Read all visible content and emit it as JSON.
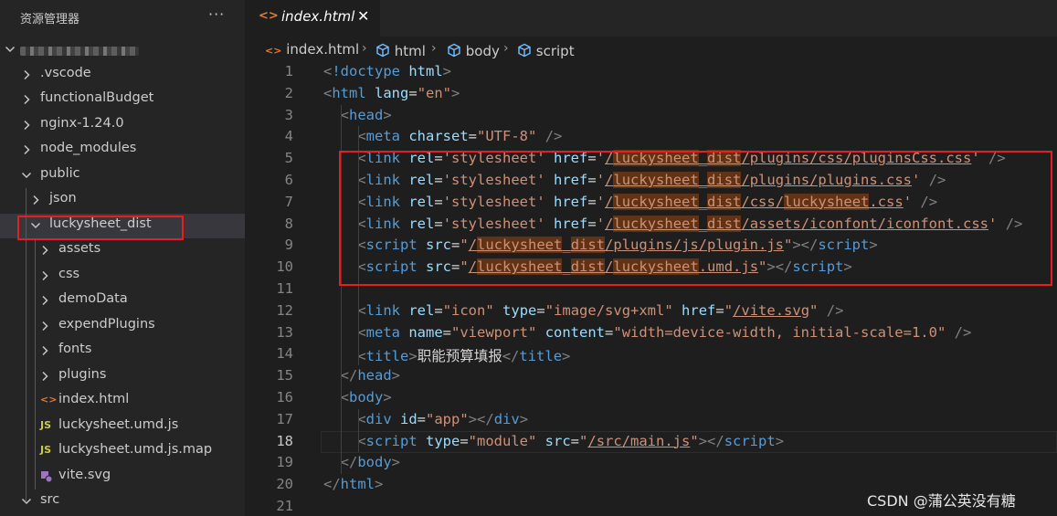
{
  "sidebar": {
    "title": "资源管理器",
    "more_actions": "···",
    "highlight_color": "#e51e1e",
    "tree": [
      {
        "label": "",
        "kind": "folder-open",
        "icon": "chevron-down-icon",
        "blurred": true
      },
      {
        "label": ".vscode",
        "kind": "folder",
        "icon": "chevron-right-icon"
      },
      {
        "label": "functionalBudget",
        "kind": "folder",
        "icon": "chevron-right-icon"
      },
      {
        "label": "nginx-1.24.0",
        "kind": "folder",
        "icon": "chevron-right-icon"
      },
      {
        "label": "node_modules",
        "kind": "folder",
        "icon": "chevron-right-icon"
      },
      {
        "label": "public",
        "kind": "folder-open",
        "icon": "chevron-down-icon"
      },
      {
        "label": "json",
        "kind": "folder",
        "icon": "chevron-right-icon"
      },
      {
        "label": "luckysheet_dist",
        "kind": "folder-open",
        "icon": "chevron-down-icon",
        "selected": true
      },
      {
        "label": "assets",
        "kind": "folder",
        "icon": "chevron-right-icon"
      },
      {
        "label": "css",
        "kind": "folder",
        "icon": "chevron-right-icon"
      },
      {
        "label": "demoData",
        "kind": "folder",
        "icon": "chevron-right-icon"
      },
      {
        "label": "expendPlugins",
        "kind": "folder",
        "icon": "chevron-right-icon"
      },
      {
        "label": "fonts",
        "kind": "folder",
        "icon": "chevron-right-icon"
      },
      {
        "label": "plugins",
        "kind": "folder",
        "icon": "chevron-right-icon"
      },
      {
        "label": "index.html",
        "kind": "file",
        "icon": "html-file-icon",
        "glyph": "<>",
        "color": "#e37933"
      },
      {
        "label": "luckysheet.umd.js",
        "kind": "file",
        "icon": "js-file-icon",
        "glyph": "JS",
        "color": "#cbcb41"
      },
      {
        "label": "luckysheet.umd.js.map",
        "kind": "file",
        "icon": "js-file-icon",
        "glyph": "JS",
        "color": "#cbcb41"
      },
      {
        "label": "vite.svg",
        "kind": "file",
        "icon": "svg-file-icon",
        "color": "#a074c4"
      },
      {
        "label": "src",
        "kind": "folder-open",
        "icon": "chevron-down-icon"
      }
    ]
  },
  "tab": {
    "icon_glyph": "<>",
    "label": "index.html",
    "close": "✕"
  },
  "breadcrumb": {
    "file": "index.html",
    "items": [
      "html",
      "body",
      "script"
    ],
    "separator": "›"
  },
  "editor": {
    "current_line": 18,
    "highlight_lines": [
      5,
      10
    ],
    "lines": [
      [
        [
          "p",
          "<"
        ],
        [
          "t",
          "!doctype "
        ],
        [
          "a",
          "html"
        ],
        [
          "p",
          ">"
        ]
      ],
      [
        [
          "p",
          "<"
        ],
        [
          "t",
          "html "
        ],
        [
          "a",
          "lang"
        ],
        [
          "x",
          "="
        ],
        [
          "s",
          "\"en\""
        ],
        [
          "p",
          ">"
        ]
      ],
      [
        [
          "x",
          "  "
        ],
        [
          "p",
          "<"
        ],
        [
          "t",
          "head"
        ],
        [
          "p",
          ">"
        ]
      ],
      [
        [
          "x",
          "    "
        ],
        [
          "p",
          "<"
        ],
        [
          "t",
          "meta "
        ],
        [
          "a",
          "charset"
        ],
        [
          "x",
          "="
        ],
        [
          "s",
          "\"UTF-8\""
        ],
        [
          "x",
          " "
        ],
        [
          "p",
          "/>"
        ]
      ],
      [
        [
          "x",
          "    "
        ],
        [
          "p",
          "<"
        ],
        [
          "t",
          "link "
        ],
        [
          "a",
          "rel"
        ],
        [
          "x",
          "="
        ],
        [
          "s",
          "'stylesheet'"
        ],
        [
          "x",
          " "
        ],
        [
          "a",
          "href"
        ],
        [
          "x",
          "="
        ],
        [
          "s",
          "'"
        ],
        [
          "su",
          "/"
        ],
        [
          "sh",
          "luckysheet"
        ],
        [
          "su",
          "_"
        ],
        [
          "sh",
          "dist"
        ],
        [
          "su",
          "/plugins/css/pluginsCss.css"
        ],
        [
          "s",
          "'"
        ],
        [
          "x",
          " "
        ],
        [
          "p",
          "/>"
        ]
      ],
      [
        [
          "x",
          "    "
        ],
        [
          "p",
          "<"
        ],
        [
          "t",
          "link "
        ],
        [
          "a",
          "rel"
        ],
        [
          "x",
          "="
        ],
        [
          "s",
          "'stylesheet'"
        ],
        [
          "x",
          " "
        ],
        [
          "a",
          "href"
        ],
        [
          "x",
          "="
        ],
        [
          "s",
          "'"
        ],
        [
          "su",
          "/"
        ],
        [
          "sh",
          "luckysheet"
        ],
        [
          "su",
          "_"
        ],
        [
          "sh",
          "dist"
        ],
        [
          "su",
          "/plugins/plugins.css"
        ],
        [
          "s",
          "'"
        ],
        [
          "x",
          " "
        ],
        [
          "p",
          "/>"
        ]
      ],
      [
        [
          "x",
          "    "
        ],
        [
          "p",
          "<"
        ],
        [
          "t",
          "link "
        ],
        [
          "a",
          "rel"
        ],
        [
          "x",
          "="
        ],
        [
          "s",
          "'stylesheet'"
        ],
        [
          "x",
          " "
        ],
        [
          "a",
          "href"
        ],
        [
          "x",
          "="
        ],
        [
          "s",
          "'"
        ],
        [
          "su",
          "/"
        ],
        [
          "sh",
          "luckysheet"
        ],
        [
          "su",
          "_"
        ],
        [
          "sh",
          "dist"
        ],
        [
          "su",
          "/css/"
        ],
        [
          "sh",
          "luckysheet"
        ],
        [
          "su",
          ".css"
        ],
        [
          "s",
          "'"
        ],
        [
          "x",
          " "
        ],
        [
          "p",
          "/>"
        ]
      ],
      [
        [
          "x",
          "    "
        ],
        [
          "p",
          "<"
        ],
        [
          "t",
          "link "
        ],
        [
          "a",
          "rel"
        ],
        [
          "x",
          "="
        ],
        [
          "s",
          "'stylesheet'"
        ],
        [
          "x",
          " "
        ],
        [
          "a",
          "href"
        ],
        [
          "x",
          "="
        ],
        [
          "s",
          "'"
        ],
        [
          "su",
          "/"
        ],
        [
          "sh",
          "luckysheet"
        ],
        [
          "su",
          "_"
        ],
        [
          "sh",
          "dist"
        ],
        [
          "su",
          "/assets/iconfont/iconfont.css"
        ],
        [
          "s",
          "'"
        ],
        [
          "x",
          " "
        ],
        [
          "p",
          "/>"
        ]
      ],
      [
        [
          "x",
          "    "
        ],
        [
          "p",
          "<"
        ],
        [
          "t",
          "script "
        ],
        [
          "a",
          "src"
        ],
        [
          "x",
          "="
        ],
        [
          "s",
          "\""
        ],
        [
          "su",
          "/"
        ],
        [
          "sh",
          "luckysheet"
        ],
        [
          "su",
          "_"
        ],
        [
          "sh",
          "dist"
        ],
        [
          "su",
          "/plugins/js/plugin.js"
        ],
        [
          "s",
          "\""
        ],
        [
          "p",
          "></"
        ],
        [
          "t",
          "script"
        ],
        [
          "p",
          ">"
        ]
      ],
      [
        [
          "x",
          "    "
        ],
        [
          "p",
          "<"
        ],
        [
          "t",
          "script "
        ],
        [
          "a",
          "src"
        ],
        [
          "x",
          "="
        ],
        [
          "s",
          "\""
        ],
        [
          "su",
          "/"
        ],
        [
          "sh",
          "luckysheet"
        ],
        [
          "su",
          "_"
        ],
        [
          "sh",
          "dist"
        ],
        [
          "su",
          "/"
        ],
        [
          "sh",
          "luckysheet"
        ],
        [
          "su",
          ".umd.js"
        ],
        [
          "s",
          "\""
        ],
        [
          "p",
          "></"
        ],
        [
          "t",
          "script"
        ],
        [
          "p",
          ">"
        ]
      ],
      [],
      [
        [
          "x",
          "    "
        ],
        [
          "p",
          "<"
        ],
        [
          "t",
          "link "
        ],
        [
          "a",
          "rel"
        ],
        [
          "x",
          "="
        ],
        [
          "s",
          "\"icon\""
        ],
        [
          "x",
          " "
        ],
        [
          "a",
          "type"
        ],
        [
          "x",
          "="
        ],
        [
          "s",
          "\"image/svg+xml\""
        ],
        [
          "x",
          " "
        ],
        [
          "a",
          "href"
        ],
        [
          "x",
          "="
        ],
        [
          "s",
          "\""
        ],
        [
          "su",
          "/vite.svg"
        ],
        [
          "s",
          "\""
        ],
        [
          "x",
          " "
        ],
        [
          "p",
          "/>"
        ]
      ],
      [
        [
          "x",
          "    "
        ],
        [
          "p",
          "<"
        ],
        [
          "t",
          "meta "
        ],
        [
          "a",
          "name"
        ],
        [
          "x",
          "="
        ],
        [
          "s",
          "\"viewport\""
        ],
        [
          "x",
          " "
        ],
        [
          "a",
          "content"
        ],
        [
          "x",
          "="
        ],
        [
          "s",
          "\"width=device-width, initial-scale=1.0\""
        ],
        [
          "x",
          " "
        ],
        [
          "p",
          "/>"
        ]
      ],
      [
        [
          "x",
          "    "
        ],
        [
          "p",
          "<"
        ],
        [
          "t",
          "title"
        ],
        [
          "p",
          ">"
        ],
        [
          "x",
          "职能预算填报"
        ],
        [
          "p",
          "</"
        ],
        [
          "t",
          "title"
        ],
        [
          "p",
          ">"
        ]
      ],
      [
        [
          "x",
          "  "
        ],
        [
          "p",
          "</"
        ],
        [
          "t",
          "head"
        ],
        [
          "p",
          ">"
        ]
      ],
      [
        [
          "x",
          "  "
        ],
        [
          "p",
          "<"
        ],
        [
          "t",
          "body"
        ],
        [
          "p",
          ">"
        ]
      ],
      [
        [
          "x",
          "    "
        ],
        [
          "p",
          "<"
        ],
        [
          "t",
          "div "
        ],
        [
          "a",
          "id"
        ],
        [
          "x",
          "="
        ],
        [
          "s",
          "\"app\""
        ],
        [
          "p",
          "></"
        ],
        [
          "t",
          "div"
        ],
        [
          "p",
          ">"
        ]
      ],
      [
        [
          "x",
          "    "
        ],
        [
          "p",
          "<"
        ],
        [
          "t",
          "script "
        ],
        [
          "a",
          "type"
        ],
        [
          "x",
          "="
        ],
        [
          "s",
          "\"module\""
        ],
        [
          "x",
          " "
        ],
        [
          "a",
          "src"
        ],
        [
          "x",
          "="
        ],
        [
          "s",
          "\""
        ],
        [
          "su",
          "/src/main.js"
        ],
        [
          "s",
          "\""
        ],
        [
          "p",
          "></"
        ],
        [
          "t",
          "script"
        ],
        [
          "p",
          ">"
        ]
      ],
      [
        [
          "x",
          "  "
        ],
        [
          "p",
          "</"
        ],
        [
          "t",
          "body"
        ],
        [
          "p",
          ">"
        ]
      ],
      [
        [
          "p",
          "</"
        ],
        [
          "t",
          "html"
        ],
        [
          "p",
          ">"
        ]
      ],
      []
    ]
  },
  "watermark": "CSDN @蒲公英没有糖"
}
